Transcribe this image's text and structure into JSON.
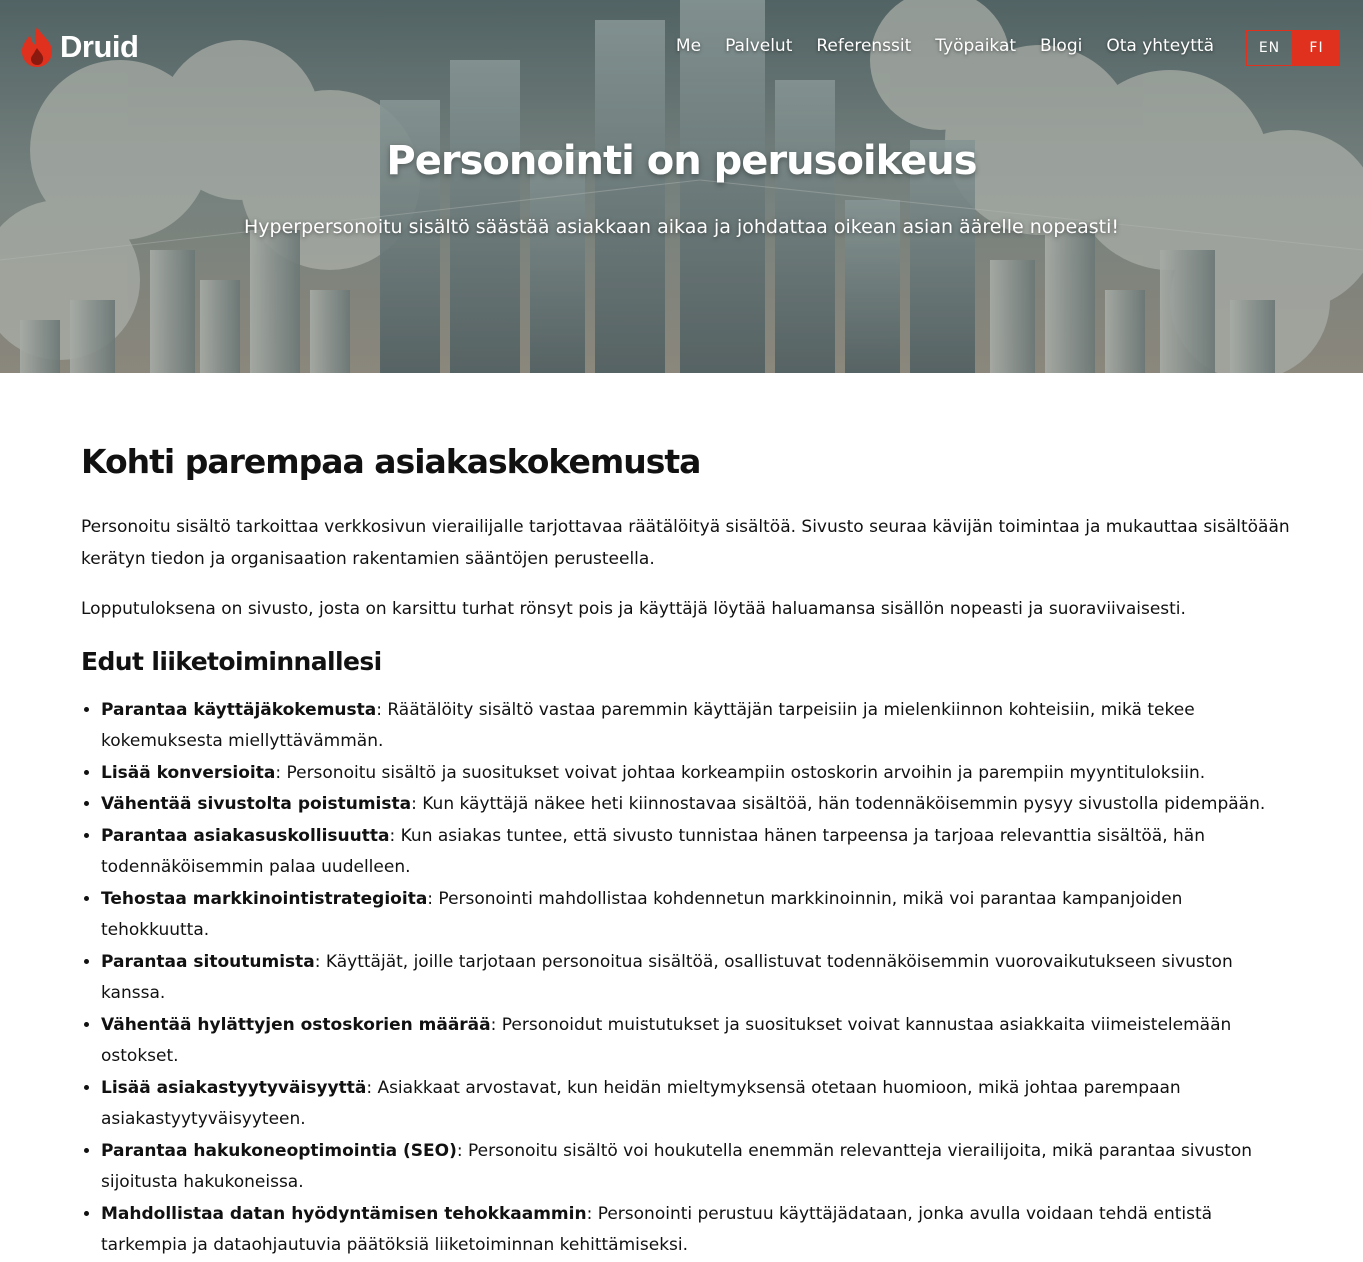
{
  "brand": {
    "name": "Druid",
    "accent": "#e0301e"
  },
  "nav": [
    "Me",
    "Palvelut",
    "Referenssit",
    "Työpaikat",
    "Blogi",
    "Ota yhteyttä"
  ],
  "lang": {
    "en": "EN",
    "fi": "FI",
    "active": "FI"
  },
  "hero": {
    "title": "Personointi on perusoikeus",
    "subtitle": "Hyperpersonoitu sisältö säästää asiakkaan aikaa ja johdattaa oikean asian äärelle nopeasti!"
  },
  "content": {
    "heading": "Kohti parempaa asiakaskokemusta",
    "para1": "Personoitu sisältö tarkoittaa verkkosivun vierailijalle tarjottavaa räätälöityä sisältöä. Sivusto seuraa kävijän toimintaa ja mukauttaa sisältöään kerätyn tiedon ja organisaation rakentamien sääntöjen perusteella.",
    "para2": "Lopputuloksena on sivusto, josta on karsittu turhat rönsyt pois ja käyttäjä löytää haluamansa sisällön nopeasti ja suoraviivaisesti.",
    "subheading": "Edut liiketoiminnallesi",
    "benefits": [
      {
        "title": "Parantaa käyttäjäkokemusta",
        "text": ": Räätälöity sisältö vastaa paremmin käyttäjän tarpeisiin ja mielenkiinnon kohteisiin, mikä tekee kokemuksesta miellyttävämmän."
      },
      {
        "title": "Lisää konversioita",
        "text": ": Personoitu sisältö ja suositukset voivat johtaa korkeampiin ostoskorin arvoihin ja parempiin myyntituloksiin."
      },
      {
        "title": "Vähentää sivustolta poistumista",
        "text": ": Kun käyttäjä näkee heti kiinnostavaa sisältöä, hän todennäköisemmin pysyy sivustolla pidempään."
      },
      {
        "title": "Parantaa asiakasuskollisuutta",
        "text": ": Kun asiakas tuntee, että sivusto tunnistaa hänen tarpeensa ja tarjoaa relevanttia sisältöä, hän todennäköisemmin palaa uudelleen."
      },
      {
        "title": "Tehostaa markkinointistrategioita",
        "text": ": Personointi mahdollistaa kohdennetun markkinoinnin, mikä voi parantaa kampanjoiden tehokkuutta."
      },
      {
        "title": "Parantaa sitoutumista",
        "text": ": Käyttäjät, joille tarjotaan personoitua sisältöä, osallistuvat todennäköisemmin vuorovaikutukseen sivuston kanssa."
      },
      {
        "title": "Vähentää hylättyjen ostoskorien määrää",
        "text": ": Personoidut muistutukset ja suositukset voivat kannustaa asiakkaita viimeistelemään ostokset."
      },
      {
        "title": "Lisää asiakastyytyväisyyttä",
        "text": ": Asiakkaat arvostavat, kun heidän mieltymyksensä otetaan huomioon, mikä johtaa parempaan asiakastyytyväisyyteen."
      },
      {
        "title": "Parantaa hakukoneoptimointia (SEO)",
        "text": ": Personoitu sisältö voi houkutella enemmän relevantteja vierailijoita, mikä parantaa sivuston sijoitusta hakukoneissa."
      },
      {
        "title": "Mahdollistaa datan hyödyntämisen tehokkaammin",
        "text": ": Personointi perustuu käyttäjädataan, jonka avulla voidaan tehdä entistä tarkempia ja dataohjautuvia päätöksiä liiketoiminnan kehittämiseksi."
      }
    ]
  }
}
